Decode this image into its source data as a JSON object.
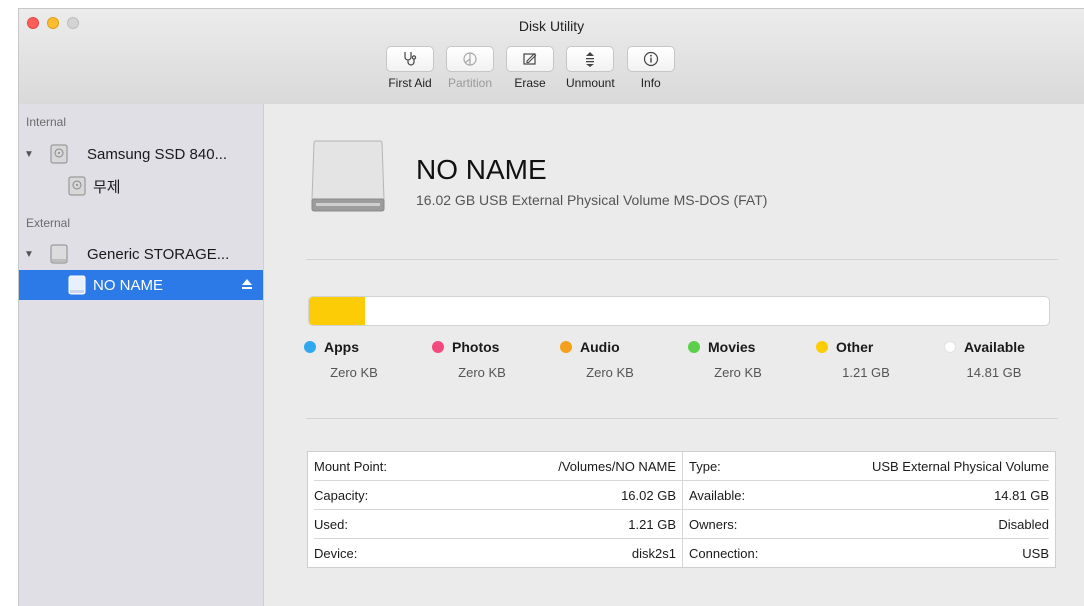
{
  "window": {
    "title": "Disk Utility"
  },
  "toolbar": [
    {
      "label": "First Aid",
      "icon": "stethoscope-icon",
      "enabled": true
    },
    {
      "label": "Partition",
      "icon": "partition-icon",
      "enabled": false
    },
    {
      "label": "Erase",
      "icon": "erase-icon",
      "enabled": true
    },
    {
      "label": "Unmount",
      "icon": "unmount-icon",
      "enabled": true
    },
    {
      "label": "Info",
      "icon": "info-icon",
      "enabled": true
    }
  ],
  "sidebar": {
    "internal_label": "Internal",
    "external_label": "External",
    "internal_disk": "Samsung SSD 840...",
    "internal_volume": "무제",
    "external_disk": "Generic STORAGE...",
    "external_volume": "NO NAME"
  },
  "volume": {
    "name": "NO NAME",
    "description": "16.02 GB USB External Physical Volume MS-DOS (FAT)"
  },
  "usage": {
    "other_fraction": 0.0755
  },
  "legend": [
    {
      "label": "Apps",
      "value": "Zero KB",
      "color": "#2fa8f0"
    },
    {
      "label": "Photos",
      "value": "Zero KB",
      "color": "#f24a7e"
    },
    {
      "label": "Audio",
      "value": "Zero KB",
      "color": "#f5a01a"
    },
    {
      "label": "Movies",
      "value": "Zero KB",
      "color": "#5ad04a"
    },
    {
      "label": "Other",
      "value": "1.21 GB",
      "color": "#fccc07"
    },
    {
      "label": "Available",
      "value": "14.81 GB",
      "color": "#ffffff"
    }
  ],
  "info": [
    {
      "left_label": "Mount Point:",
      "left_value": "/Volumes/NO NAME",
      "right_label": "Type:",
      "right_value": "USB External Physical Volume"
    },
    {
      "left_label": "Capacity:",
      "left_value": "16.02 GB",
      "right_label": "Available:",
      "right_value": "14.81 GB"
    },
    {
      "left_label": "Used:",
      "left_value": "1.21 GB",
      "right_label": "Owners:",
      "right_value": "Disabled"
    },
    {
      "left_label": "Device:",
      "left_value": "disk2s1",
      "right_label": "Connection:",
      "right_value": "USB"
    }
  ]
}
